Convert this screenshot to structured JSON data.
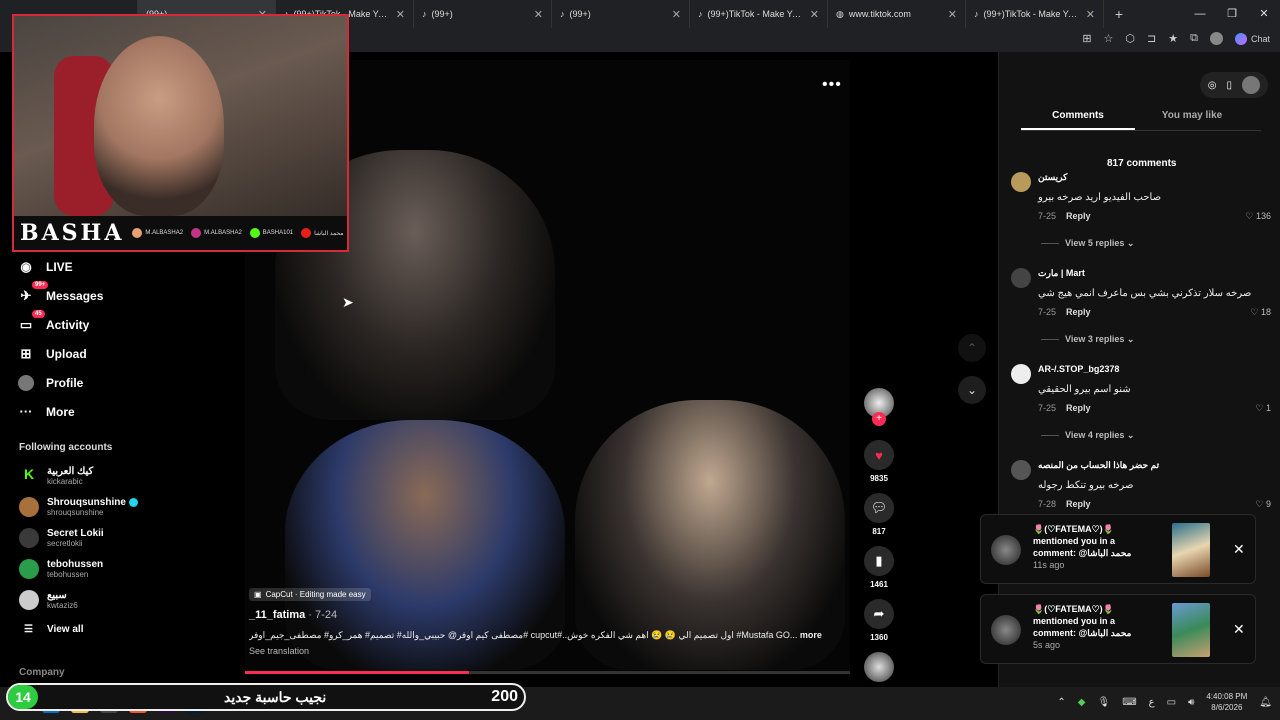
{
  "tabs": [
    {
      "title": "",
      "partial": true
    },
    {
      "title": "(99+)",
      "active": true
    },
    {
      "title": "(99+)TikTok - Make Your Day"
    },
    {
      "title": "(99+)"
    },
    {
      "title": "(99+)"
    },
    {
      "title": "(99+)TikTok - Make Your Day"
    },
    {
      "title": "www.tiktok.com"
    },
    {
      "title": "(99+)TikTok - Make Your Day"
    }
  ],
  "browser": {
    "chat_label": "Chat"
  },
  "webcam": {
    "name": "BASHA",
    "tags": [
      "M.ALBASHA2",
      "M.ALBASHA2",
      "BASHA101",
      "محمد الباشا"
    ]
  },
  "sidenav": {
    "items": [
      {
        "label": "LIVE",
        "icon": "live-icon"
      },
      {
        "label": "Messages",
        "icon": "messages-icon",
        "badge": "99+"
      },
      {
        "label": "Activity",
        "icon": "activity-icon",
        "badge": "45"
      },
      {
        "label": "Upload",
        "icon": "upload-icon"
      },
      {
        "label": "Profile",
        "icon": "profile-icon"
      },
      {
        "label": "More",
        "icon": "more-icon"
      }
    ],
    "following_title": "Following accounts",
    "accounts": [
      {
        "name": "كيك العربية",
        "user": "kickarabic",
        "color": "#53fc18"
      },
      {
        "name": "Shrouqsunshine",
        "user": "shrouqsunshine",
        "color": "#a8703a",
        "verified": true
      },
      {
        "name": "Secret Lokii",
        "user": "secretlokii",
        "color": "#3a3a3a"
      },
      {
        "name": "tebohussen",
        "user": "tebohussen",
        "color": "#2a9d4a"
      },
      {
        "name": "سبيع",
        "user": "kwtaziz6",
        "color": "#cccccc"
      }
    ],
    "view_all": "View all",
    "company": "Company"
  },
  "video": {
    "capcut": "CapCut · Editing made easy",
    "author": "_11_fatima",
    "date": "· 7-24",
    "description": "مصطفى كيم اوفر@ حبيبي_والله# تصميم# همر_كرو# مصطفى_جيم_اوفر# cupcut#..اول تصميم الي 😢 😢 اهم شي الفكره خوش #Mustafa GO...",
    "more": "more",
    "see_translation": "See translation",
    "progress_fraction": 0.37,
    "actions": {
      "likes": "9835",
      "comments": "817",
      "saves": "1461",
      "shares": "1360"
    }
  },
  "panel": {
    "tab_comments": "Comments",
    "tab_maylike": "You may like",
    "count": "817 comments",
    "comments": [
      {
        "name": "كريستن",
        "text": "صاحب الفيديو اريد صرخه بيرو",
        "date": "7-25",
        "reply": "Reply",
        "likes": "136",
        "replies": "View 5 replies"
      },
      {
        "name": "مارت | Mart",
        "text": "صرخه سلار تذكرني بشي بس ماعرف انمي هيج شي",
        "date": "7-25",
        "reply": "Reply",
        "likes": "18",
        "replies": "View 3 replies"
      },
      {
        "name": "AR-/.STOP_bg2378",
        "text": "شنو اسم بيرو الحقيقي",
        "date": "7-25",
        "reply": "Reply",
        "likes": "1",
        "replies": "View 4 replies"
      },
      {
        "name": "تم حضر هاذا الحساب من المنصه",
        "text": "صرخه بيرو تنكط رجوله",
        "date": "7-28",
        "reply": "Reply",
        "likes": "9",
        "replies": ""
      }
    ]
  },
  "notifications": [
    {
      "title": "🌷(♡FATEMA♡)🌷",
      "body": "mentioned you in a comment: @محمد الباشا",
      "time": "11s ago"
    },
    {
      "title": "🌷(♡FATEMA♡)🌷",
      "body": "mentioned you in a comment: @محمد الباشا",
      "time": "5s ago"
    }
  ],
  "overlay": {
    "number": "14",
    "name": "نجيب حاسبة جديد",
    "score": "200"
  },
  "taskbar": {
    "time": "4:40:08 PM",
    "date": "8/6/2026",
    "lang": "ع"
  }
}
